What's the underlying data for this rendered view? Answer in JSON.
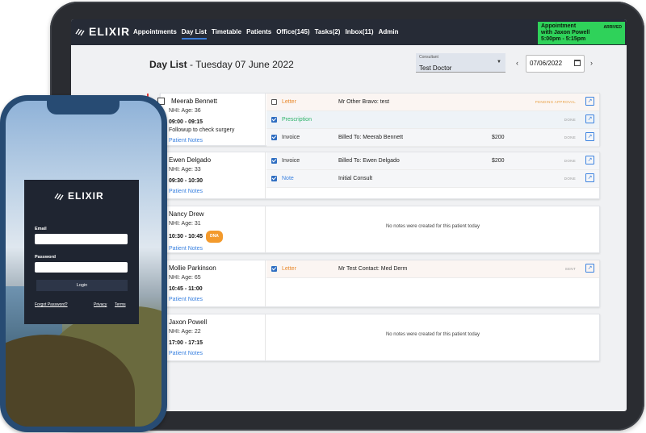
{
  "app": {
    "brand": "ELIXIR",
    "nav": [
      "Appointments",
      "Day List",
      "Timetable",
      "Patients",
      "Office(145)",
      "Tasks",
      "Inbox(11)",
      "Admin"
    ],
    "tasks_badge": "(2)",
    "active_nav": "Day List"
  },
  "arrived": {
    "line1": "Appointment",
    "line2": "with Jaxon Powell",
    "line3": "5:00pm - 5:15pm",
    "status": "ARRIVED"
  },
  "daylist": {
    "title": "Day List",
    "separator": " - ",
    "date": "Tuesday 07 June 2022"
  },
  "consultant": {
    "label": "Consultant",
    "value": "Test Doctor"
  },
  "date_input": {
    "value": "07/06/2022"
  },
  "nav_prev": "‹",
  "nav_next": "›",
  "patients": [
    {
      "name": "Meerab Bennett",
      "nhi": "NHI:  Age: 36",
      "time": "09:00 - 09:15",
      "note": "Followup to check surgery",
      "link": "Patient Notes",
      "tasks": [
        {
          "type": "Letter",
          "desc": "Mr Other Bravo: test",
          "amount": "",
          "status": "PENDING APPROVAL",
          "checked": false
        },
        {
          "type": "Prescription",
          "desc": "",
          "amount": "",
          "status": "DONE",
          "checked": true
        },
        {
          "type": "Invoice",
          "desc": "Billed To: Meerab Bennett",
          "amount": "$200",
          "status": "DONE",
          "checked": true
        }
      ]
    },
    {
      "name": "Ewen Delgado",
      "nhi": "NHI:  Age: 33",
      "time": "09:30 - 10:30",
      "note": "",
      "link": "Patient Notes",
      "tasks": [
        {
          "type": "Invoice",
          "desc": "Billed To: Ewen Delgado",
          "amount": "$200",
          "status": "DONE",
          "checked": true
        },
        {
          "type": "Note",
          "desc": "Initial Consult",
          "amount": "",
          "status": "DONE",
          "checked": true
        }
      ]
    },
    {
      "name": "Nancy Drew",
      "nhi": "NHI:  Age: 31",
      "time": "10:30 - 10:45",
      "badge": "DNA",
      "note": "",
      "link": "Patient Notes",
      "empty": "No notes were created for this patient today"
    },
    {
      "name": "Mollie Parkinson",
      "nhi": "NHI:  Age: 65",
      "time": "10:45 - 11:00",
      "note": "",
      "link": "Patient Notes",
      "tasks": [
        {
          "type": "Letter",
          "desc": "Mr Test Contact: Med Derm",
          "amount": "",
          "status": "SENT",
          "checked": true
        }
      ]
    },
    {
      "name": "Jaxon Powell",
      "nhi": "NHI:  Age: 22",
      "time": "17:00 - 17:15",
      "note": "",
      "link": "Patient Notes",
      "empty": "No notes were created for this patient today"
    }
  ],
  "login": {
    "brand": "ELIXIR",
    "email_label": "Email",
    "password_label": "Password",
    "button": "Login",
    "forgot": "Forgot Password?",
    "privacy": "Privacy",
    "terms": "Terms"
  },
  "colors": {
    "nav_bg": "#262b36",
    "arrived_bg": "#2fd25a",
    "link_blue": "#3b82e0",
    "letter_orange": "#e8892c",
    "prescription_green": "#2eb36a",
    "dna_orange": "#f39a2c",
    "phone_frame": "#274b73"
  },
  "icons": [
    "elixir-logo-icon",
    "dropdown-caret-icon",
    "calendar-icon",
    "checkbox-icon",
    "open-external-icon"
  ]
}
